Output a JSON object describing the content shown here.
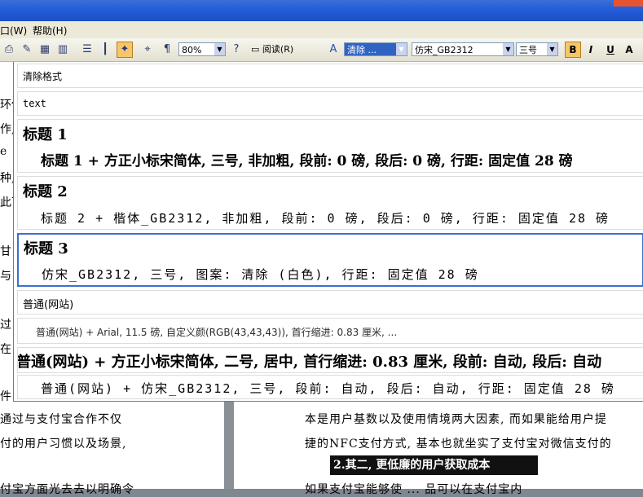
{
  "menubar": {
    "window": "口(W)",
    "help": "帮助(H)"
  },
  "toolbar": {
    "zoom": "80%",
    "read_label": "阅读(R)",
    "style_value": "清除 ...",
    "font_value": "仿宋_GB2312",
    "size_value": "三号",
    "bold": "B",
    "italic": "I",
    "underline": "U",
    "fontcolor": "A"
  },
  "left_doc": {
    "fragments": [
      "环保",
      "作,",
      "e",
      "种,",
      "此可",
      "甘",
      "与",
      "过",
      "在",
      "件"
    ],
    "line1": "通过与支付宝合作不仅",
    "line2": "付的用户习惯以及场景,",
    "line3": "付宝方面光去去以明确令"
  },
  "right_doc": {
    "line1": "本是用户基数以及使用情境两大因素, 而如果能给用户提",
    "line2": "捷的NFC支付方式, 基本也就坐实了支付宝对微信支付的",
    "heading": "2.其二, 更低廉的用户获取成本",
    "line3": "如果支付宝能够使 ... 品可以在支付宝内"
  },
  "styles_panel": {
    "items": [
      {
        "name": "清除格式"
      },
      {
        "name": "text"
      },
      {
        "name": "标题 1",
        "desc": "标题 1 + 方正小标宋简体, 三号, 非加粗, 段前: 0 磅, 段后: 0 磅, 行距: 固定值 28 磅"
      },
      {
        "name": "标题 2",
        "desc": "标题 2 + 楷体_GB2312, 非加粗, 段前: 0 磅, 段后: 0 磅, 行距: 固定值 28 磅"
      },
      {
        "name": "标题 3",
        "desc": "仿宋_GB2312, 三号, 图案: 清除 (白色), 行距: 固定值 28 磅"
      },
      {
        "name": "普通(网站)"
      },
      {
        "desc": "普通(网站) + Arial, 11.5 磅, 自定义颜(RGB(43,43,43)), 首行缩进: 0.83 厘米, ..."
      },
      {
        "desc": "普通(网站) + 方正小标宋简体, 二号, 居中, 首行缩进: 0.83 厘米, 段前: 自动, 段后: 自动"
      },
      {
        "desc": "普通(网站) + 仿宋_GB2312, 三号, 段前: 自动, 段后: 自动, 行距: 固定值 28 磅"
      }
    ]
  }
}
